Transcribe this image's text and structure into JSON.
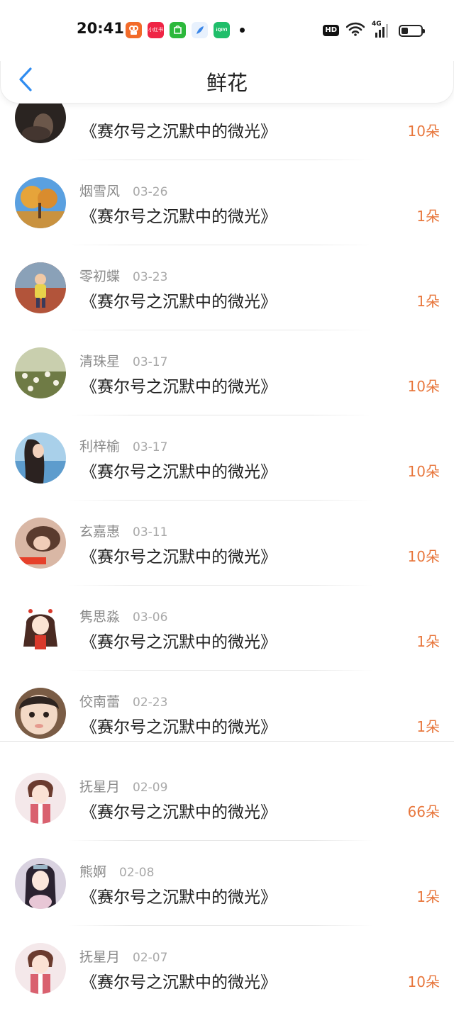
{
  "status_bar": {
    "time": "20:41",
    "apps": [
      {
        "icon": "kuaishou-icon",
        "label": "",
        "color": "#f26b2a"
      },
      {
        "icon": "xiaohongshu-icon",
        "label": "小红书",
        "color": "#ef2545"
      },
      {
        "icon": "wechat-pay-icon",
        "label": "",
        "color": "#2cb83b"
      },
      {
        "icon": "feather-app-icon",
        "label": "",
        "color": "#3a86e8"
      },
      {
        "icon": "iqiyi-icon",
        "label": "iQIYI",
        "color": "#1fbe6a"
      }
    ],
    "hd_label": "HD",
    "network_label": "4G"
  },
  "header": {
    "title": "鲜花"
  },
  "colors": {
    "count": "#e8773d",
    "back_arrow": "#2f8cf0"
  },
  "gifts": [
    {
      "name": "",
      "date": "",
      "work": "《赛尔号之沉默中的微光》",
      "count": "10朵",
      "avatar": "dark-portrait"
    },
    {
      "name": "烟雪风",
      "date": "03-26",
      "work": "《赛尔号之沉默中的微光》",
      "count": "1朵",
      "avatar": "autumn-tree"
    },
    {
      "name": "零初蝶",
      "date": "03-23",
      "work": "《赛尔号之沉默中的微光》",
      "count": "1朵",
      "avatar": "child-leaves"
    },
    {
      "name": "清珠星",
      "date": "03-17",
      "work": "《赛尔号之沉默中的微光》",
      "count": "10朵",
      "avatar": "wildflowers"
    },
    {
      "name": "利梓榆",
      "date": "03-17",
      "work": "《赛尔号之沉默中的微光》",
      "count": "10朵",
      "avatar": "girl-by-sea"
    },
    {
      "name": "玄嘉惠",
      "date": "03-11",
      "work": "《赛尔号之沉默中的微光》",
      "count": "10朵",
      "avatar": "sleeping-girl"
    },
    {
      "name": "隽思淼",
      "date": "03-06",
      "work": "《赛尔号之沉默中的微光》",
      "count": "1朵",
      "avatar": "cartoon-girl"
    },
    {
      "name": "佼南蕾",
      "date": "02-23",
      "work": "《赛尔号之沉默中的微光》",
      "count": "1朵",
      "avatar": "toddler"
    },
    {
      "name": "抚星月",
      "date": "02-09",
      "work": "《赛尔号之沉默中的微光》",
      "count": "66朵",
      "avatar": "anime-boy"
    },
    {
      "name": "熊婀",
      "date": "02-08",
      "work": "《赛尔号之沉默中的微光》",
      "count": "1朵",
      "avatar": "ancient-lady"
    },
    {
      "name": "抚星月",
      "date": "02-07",
      "work": "《赛尔号之沉默中的微光》",
      "count": "10朵",
      "avatar": "anime-boy"
    }
  ]
}
